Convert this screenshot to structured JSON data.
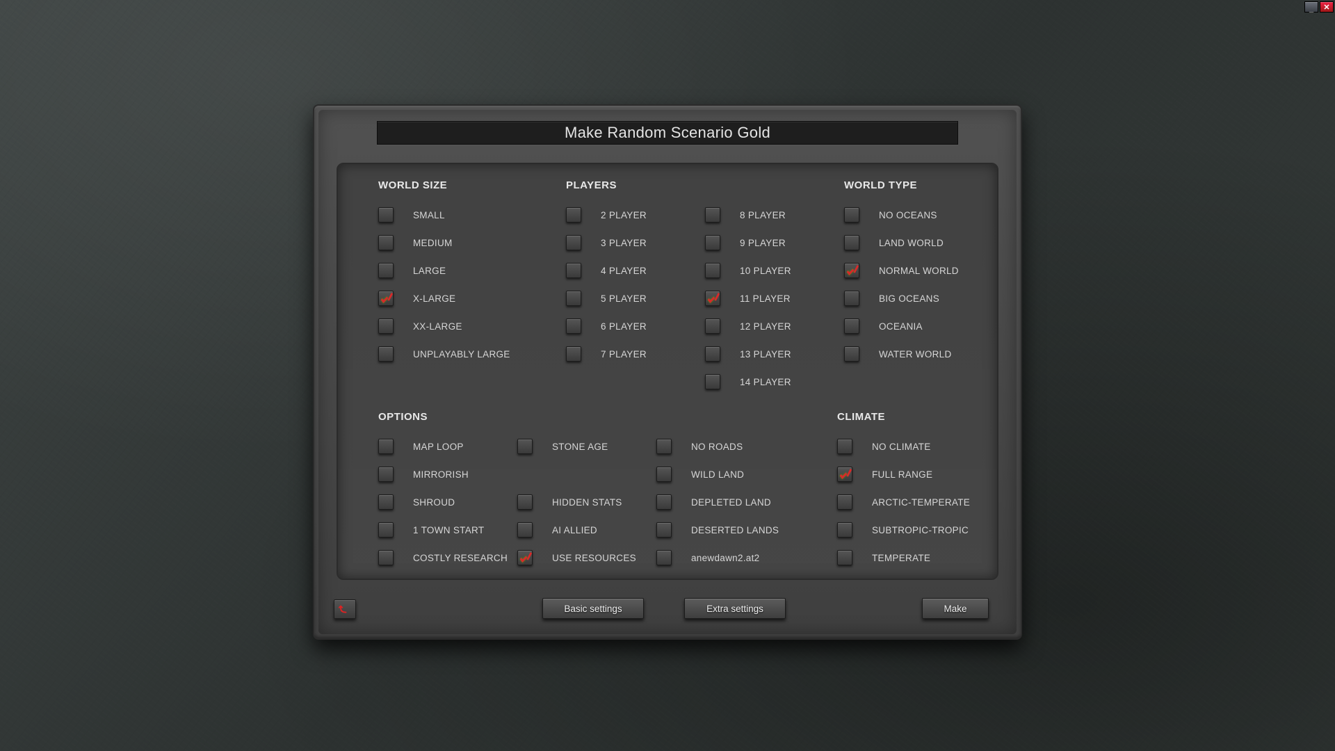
{
  "title": "Make Random Scenario Gold",
  "sections": {
    "world_size": {
      "heading": "WORLD SIZE",
      "items": [
        {
          "label": "SMALL",
          "checked": false
        },
        {
          "label": "MEDIUM",
          "checked": false
        },
        {
          "label": "LARGE",
          "checked": false
        },
        {
          "label": "X-LARGE",
          "checked": true
        },
        {
          "label": "XX-LARGE",
          "checked": false
        },
        {
          "label": "UNPLAYABLY LARGE",
          "checked": false
        }
      ]
    },
    "players": {
      "heading": "PLAYERS",
      "col1": [
        {
          "label": "2 PLAYER",
          "checked": false
        },
        {
          "label": "3 PLAYER",
          "checked": false
        },
        {
          "label": "4 PLAYER",
          "checked": false
        },
        {
          "label": "5 PLAYER",
          "checked": false
        },
        {
          "label": "6 PLAYER",
          "checked": false
        },
        {
          "label": "7 PLAYER",
          "checked": false
        }
      ],
      "col2": [
        {
          "label": "8 PLAYER",
          "checked": false
        },
        {
          "label": "9 PLAYER",
          "checked": false
        },
        {
          "label": "10 PLAYER",
          "checked": false
        },
        {
          "label": "11 PLAYER",
          "checked": true
        },
        {
          "label": "12 PLAYER",
          "checked": false
        },
        {
          "label": "13 PLAYER",
          "checked": false
        },
        {
          "label": "14 PLAYER",
          "checked": false
        }
      ]
    },
    "world_type": {
      "heading": "WORLD TYPE",
      "items": [
        {
          "label": "NO OCEANS",
          "checked": false
        },
        {
          "label": "LAND WORLD",
          "checked": false
        },
        {
          "label": "NORMAL WORLD",
          "checked": true
        },
        {
          "label": "BIG OCEANS",
          "checked": false
        },
        {
          "label": "OCEANIA",
          "checked": false
        },
        {
          "label": "WATER WORLD",
          "checked": false
        }
      ]
    },
    "options": {
      "heading": "OPTIONS",
      "col1": [
        {
          "label": "MAP LOOP",
          "checked": false
        },
        {
          "label": "MIRRORISH",
          "checked": false
        },
        {
          "label": "SHROUD",
          "checked": false
        },
        {
          "label": "1 TOWN START",
          "checked": false
        },
        {
          "label": "COSTLY RESEARCH",
          "checked": false
        }
      ],
      "col2": [
        {
          "label": "STONE AGE",
          "checked": false
        },
        {
          "label": "",
          "checked": null
        },
        {
          "label": "HIDDEN STATS",
          "checked": false
        },
        {
          "label": "AI ALLIED",
          "checked": false
        },
        {
          "label": "USE RESOURCES",
          "checked": true
        }
      ],
      "col3": [
        {
          "label": "NO ROADS",
          "checked": false
        },
        {
          "label": "WILD LAND",
          "checked": false
        },
        {
          "label": "DEPLETED LAND",
          "checked": false
        },
        {
          "label": "DESERTED LANDS",
          "checked": false
        },
        {
          "label": "anewdawn2.at2",
          "checked": false
        }
      ]
    },
    "climate": {
      "heading": "CLIMATE",
      "items": [
        {
          "label": "NO CLIMATE",
          "checked": false
        },
        {
          "label": "FULL RANGE",
          "checked": true
        },
        {
          "label": "ARCTIC-TEMPERATE",
          "checked": false
        },
        {
          "label": "SUBTROPIC-TROPIC",
          "checked": false
        },
        {
          "label": "TEMPERATE",
          "checked": false
        }
      ]
    }
  },
  "buttons": {
    "basic": "Basic settings",
    "extra": "Extra settings",
    "make": "Make"
  }
}
